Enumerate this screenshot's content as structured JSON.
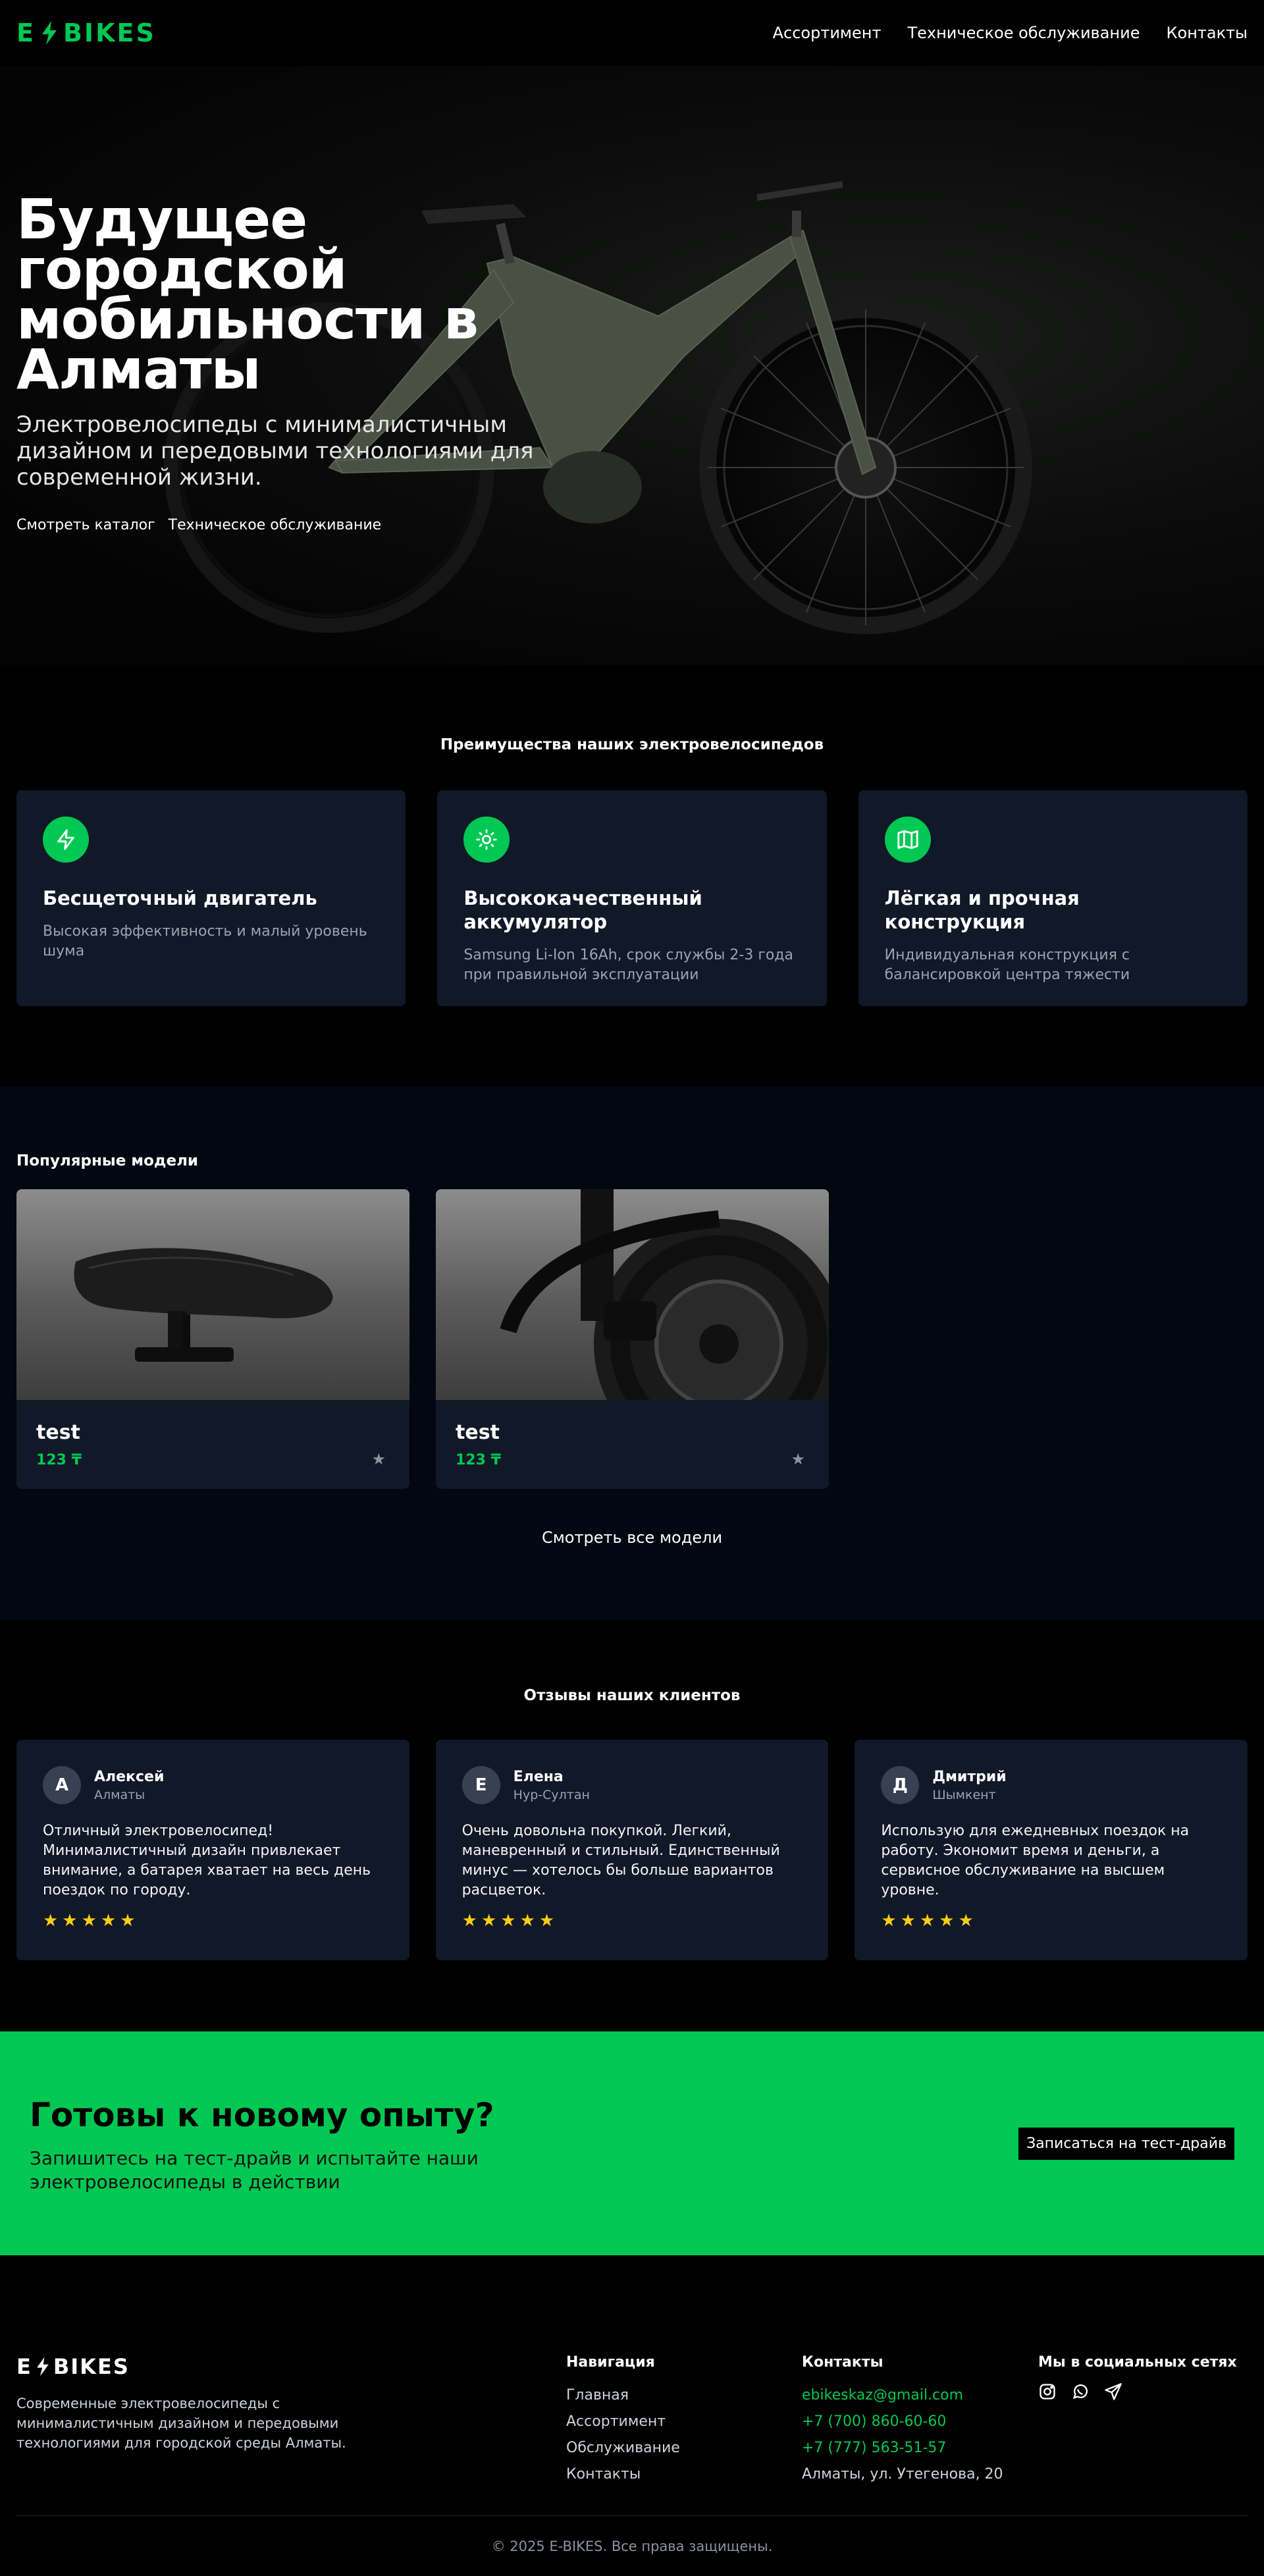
{
  "header": {
    "logo": "E-BIKES",
    "nav": [
      "Ассортимент",
      "Техническое обслуживание",
      "Контакты"
    ]
  },
  "hero": {
    "title": "Будущее городской мобильности в Алматы",
    "subtitle": "Электровелосипеды с минималистичным дизайном и передовыми технологиями для современной жизни.",
    "link_catalog": "Смотреть каталог",
    "link_service": "Техническое обслуживание"
  },
  "advantages": {
    "title": "Преимущества наших электровелосипедов",
    "items": [
      {
        "icon": "lightning-icon",
        "title": "Бесщеточный двигатель",
        "text": "Высокая эффективность и малый уровень шума"
      },
      {
        "icon": "sun-icon",
        "title": "Высококачественный аккумулятор",
        "text": "Samsung Li-Ion 16Ah, срок службы 2-3 года при правильной эксплуатации"
      },
      {
        "icon": "map-icon",
        "title": "Лёгкая и прочная конструкция",
        "text": "Индивидуальная конструкция с балансировкой центра тяжести"
      }
    ]
  },
  "popular": {
    "title": "Популярные модели",
    "items": [
      {
        "name": "test",
        "price": "123 ₸"
      },
      {
        "name": "test",
        "price": "123 ₸"
      }
    ],
    "all_link": "Смотреть все модели"
  },
  "reviews": {
    "title": "Отзывы наших клиентов",
    "items": [
      {
        "initial": "А",
        "name": "Алексей",
        "city": "Алматы",
        "text": "Отличный электровелосипед! Минималистичный дизайн привлекает внимание, а батарея хватает на весь день поездок по городу.",
        "stars": "★★★★★"
      },
      {
        "initial": "Е",
        "name": "Елена",
        "city": "Нур-Султан",
        "text": "Очень довольна покупкой. Легкий, маневренный и стильный. Единственный минус — хотелось бы больше вариантов расцветок.",
        "stars": "★★★★★"
      },
      {
        "initial": "Д",
        "name": "Дмитрий",
        "city": "Шымкент",
        "text": "Использую для ежедневных поездок на работу. Экономит время и деньги, а сервисное обслуживание на высшем уровне.",
        "stars": "★★★★★"
      }
    ]
  },
  "cta": {
    "title": "Готовы к новому опыту?",
    "subtitle": "Запишитесь на тест-драйв и испытайте наши электровелосипеды в действии",
    "button": "Записаться на тест-драйв"
  },
  "footer": {
    "logo": "E BIKES",
    "description": "Современные электровелосипеды с минималистичным дизайном и передовыми технологиями для городской среды Алматы.",
    "nav_title": "Навигация",
    "nav": [
      "Главная",
      "Ассортимент",
      "Обслуживание",
      "Контакты"
    ],
    "contacts_title": "Контакты",
    "email": "ebikeskaz@gmail.com",
    "phone1": "+7 (700) 860-60-60",
    "phone2": "+7 (777) 563-51-57",
    "address": "Алматы, ул. Утегенова, 20",
    "social_title": "Мы в социальных сетях",
    "copyright": "© 2025 E-BIKES. Все права защищены."
  },
  "colors": {
    "accent": "#00c853",
    "card": "#111827",
    "star": "#facc15"
  }
}
